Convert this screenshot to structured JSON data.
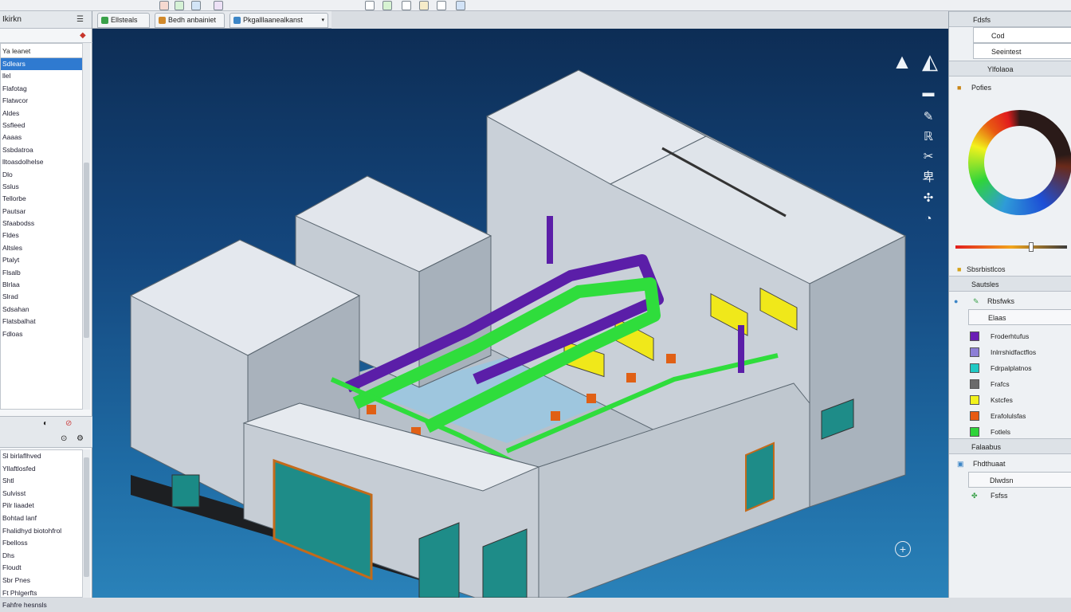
{
  "left_panel": {
    "header_label": "Ikirkn",
    "tree_input": "Ya leanet",
    "tree_items": [
      "Sdlears",
      "llel",
      "Flafotag",
      "Flatwcor",
      "Aldes",
      "Ssfleed",
      "Aaaas",
      "Ssbdatroa",
      "lltoasdolhelse",
      "Dlo",
      "Sslus",
      "Tellorbe",
      "Pautsar",
      "Sfaabodss",
      "Fldes",
      "Altsles",
      "Ptalyt",
      "Flsalb",
      "Blrlaa",
      "Slrad",
      "Sdsahan",
      "Flatsbalhat",
      "Fdloas"
    ],
    "list2_items": [
      "Sl birlaflhved",
      "Yllaftlosfed",
      "Shtl",
      "Sulvisst",
      "Pilr liaadet",
      "Bohtad lanf",
      "Fhalidhyd biotohfrol",
      "Fbelloss",
      "Dhs",
      "Floudt",
      "Sbr Pnes",
      "Ft Phlgerfts",
      "Fahfre hesnsls"
    ]
  },
  "toolbar": {
    "tabs": [
      {
        "label": "Ellsteals",
        "icon_color": "#3aa14a"
      },
      {
        "label": "Bedh anbainiet",
        "icon_color": "#d1892b"
      },
      {
        "label": "Pkgalllaanealkanst",
        "icon_color": "#3d86c7"
      }
    ]
  },
  "viewport": {
    "tools": [
      "navcube-icon",
      "rotate-icon",
      "pan-icon",
      "zoom-icon",
      "section-icon",
      "view-icon"
    ]
  },
  "right_panel": {
    "top_items": [
      "Fdsfs",
      "Cod",
      "Seeintest",
      "Ylfolaoa",
      "Pofies"
    ],
    "color_range_label": "Sbsrbistlcos",
    "legend_header": "Sautsles",
    "legend_subheader": "Rbsfwks",
    "legend_group": "Elaas",
    "legend": [
      {
        "label": "Froderhtufus",
        "color": "#6a1db5"
      },
      {
        "label": "Inlrrshidfactflos",
        "color": "#8d7fd6"
      },
      {
        "label": "Fdrpalplatnos",
        "color": "#1fc9c4"
      },
      {
        "label": "Frafcs",
        "color": "#6b6b6b"
      },
      {
        "label": "Kstcfes",
        "color": "#f2f21c"
      },
      {
        "label": "Erafolulsfas",
        "color": "#e85a12"
      },
      {
        "label": "Fotlels",
        "color": "#2fd43a"
      }
    ],
    "bottom_header": "Falaabus",
    "bottom_item1": "Fhdthuaat",
    "bottom_item2": "Dlwdsn",
    "bottom_item3": "Fsfss"
  }
}
